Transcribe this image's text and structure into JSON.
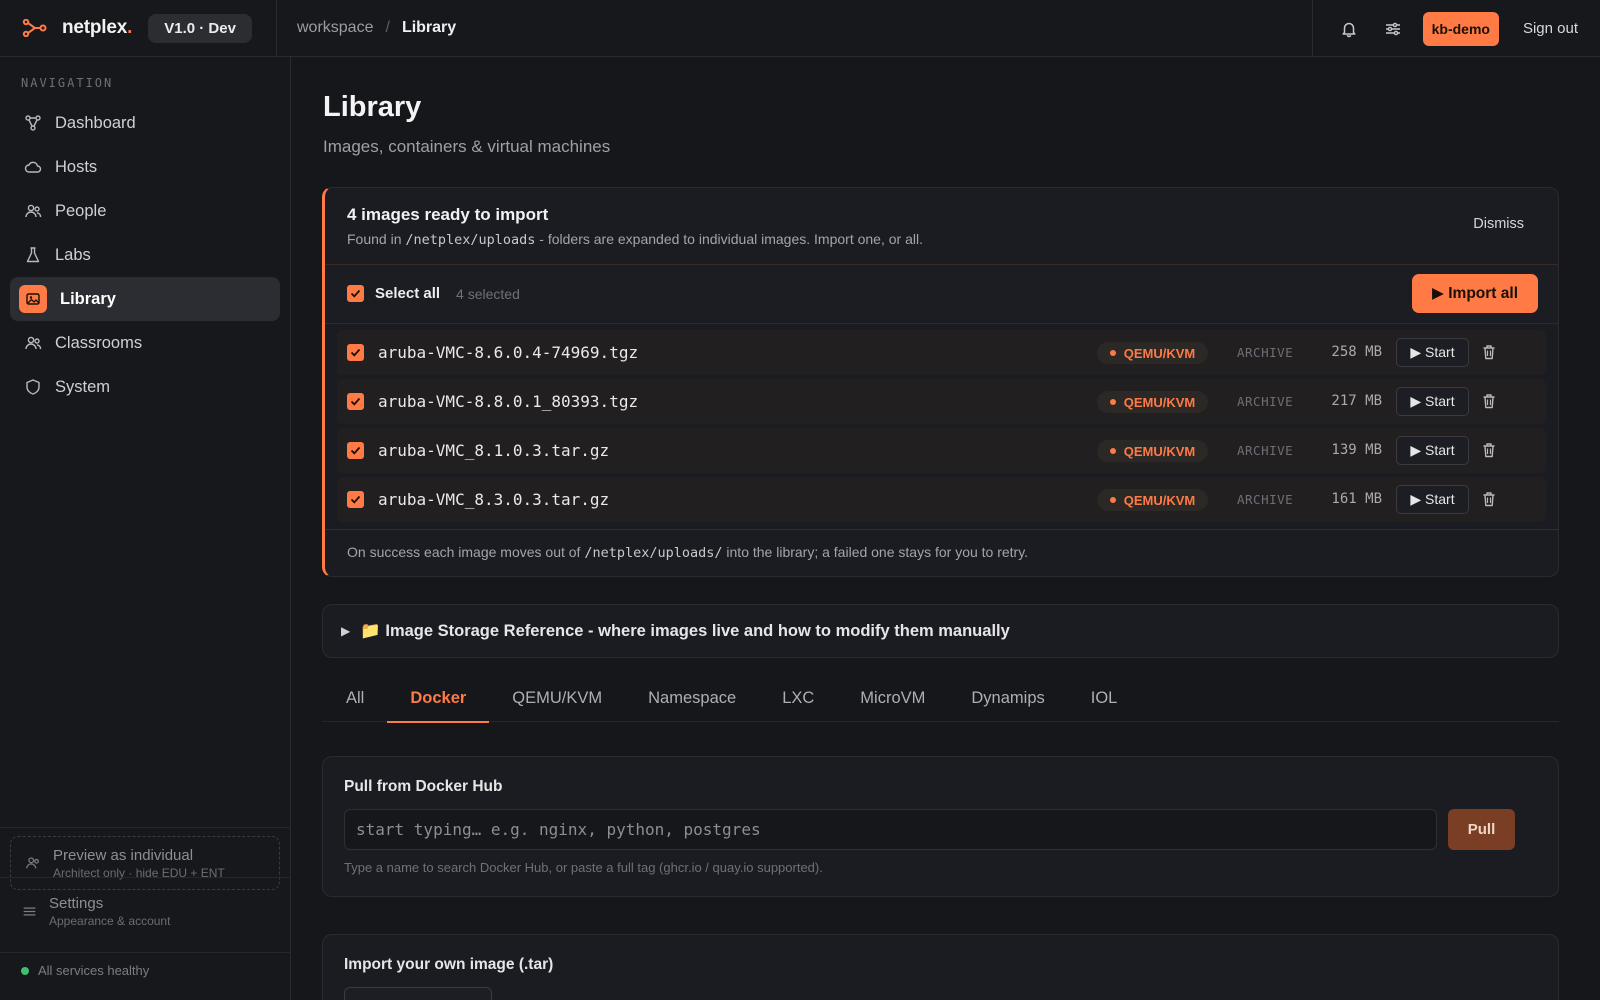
{
  "app": {
    "brand": "netplex",
    "brand_dot": ".",
    "version": "V1.0 · Dev",
    "breadcrumb": {
      "root": "workspace",
      "separator": "/",
      "current": "Library"
    },
    "user": "kb-demo",
    "signout": "Sign out"
  },
  "sidebar": {
    "heading": "NAVIGATION",
    "items": [
      {
        "label": "Dashboard",
        "icon": "graph-icon"
      },
      {
        "label": "Hosts",
        "icon": "cloud-icon"
      },
      {
        "label": "People",
        "icon": "people-icon"
      },
      {
        "label": "Labs",
        "icon": "flask-icon"
      },
      {
        "label": "Library",
        "icon": "image-icon",
        "active": true
      },
      {
        "label": "Classrooms",
        "icon": "people-icon"
      },
      {
        "label": "System",
        "icon": "shield-icon"
      }
    ],
    "preview": {
      "title": "Preview as individual",
      "subtitle": "Architect only · hide EDU + ENT"
    },
    "settings": {
      "title": "Settings",
      "subtitle": "Appearance & account"
    },
    "health": "All services healthy"
  },
  "page": {
    "title": "Library",
    "subtitle": "Images, containers & virtual machines"
  },
  "import": {
    "title": "4 images ready to import",
    "desc_before": "Found in ",
    "desc_path": "/netplex/uploads",
    "desc_after": " - folders are expanded to individual images. Import one, or all.",
    "dismiss": "Dismiss",
    "select_all": "Select all",
    "selected_count": "4 selected",
    "import_all": "▶ Import all",
    "rows": [
      {
        "name": "aruba-VMC-8.6.0.4-74969.tgz",
        "type": "QEMU/KVM",
        "kind": "ARCHIVE",
        "size": "258 MB",
        "start": "▶ Start"
      },
      {
        "name": "aruba-VMC-8.8.0.1_80393.tgz",
        "type": "QEMU/KVM",
        "kind": "ARCHIVE",
        "size": "217 MB",
        "start": "▶ Start"
      },
      {
        "name": "aruba-VMC_8.1.0.3.tar.gz",
        "type": "QEMU/KVM",
        "kind": "ARCHIVE",
        "size": "139 MB",
        "start": "▶ Start"
      },
      {
        "name": "aruba-VMC_8.3.0.3.tar.gz",
        "type": "QEMU/KVM",
        "kind": "ARCHIVE",
        "size": "161 MB",
        "start": "▶ Start"
      }
    ],
    "foot_before": "On success each image moves out of ",
    "foot_path": "/netplex/uploads/",
    "foot_after": " into the library; a failed one stays for you to retry."
  },
  "storage_ref": {
    "toggle": "▶",
    "label": "📁 Image Storage Reference - where images live and how to modify them manually"
  },
  "tabs": [
    {
      "label": "All"
    },
    {
      "label": "Docker",
      "active": true
    },
    {
      "label": "QEMU/KVM"
    },
    {
      "label": "Namespace"
    },
    {
      "label": "LXC"
    },
    {
      "label": "MicroVM"
    },
    {
      "label": "Dynamips"
    },
    {
      "label": "IOL"
    }
  ],
  "pull": {
    "title": "Pull from Docker Hub",
    "placeholder": "start typing… e.g. nginx, python, postgres",
    "button": "Pull",
    "help": "Type a name to search Docker Hub, or paste a full tag (ghcr.io / quay.io supported)."
  },
  "own_import": {
    "title": "Import your own image (.tar)"
  },
  "colors": {
    "accent": "#ff7a45",
    "background": "#16171b",
    "healthy": "#3fbf6f"
  }
}
